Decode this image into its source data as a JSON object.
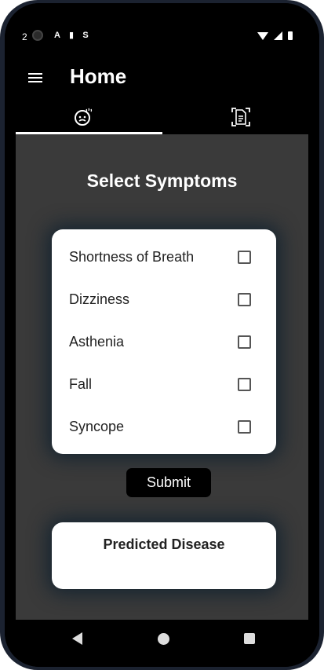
{
  "status_bar": {
    "time": "2",
    "left_icons": [
      "A",
      "▮",
      "S"
    ]
  },
  "app_bar": {
    "title": "Home",
    "menu_icon": "menu-icon"
  },
  "tabs": [
    {
      "icon": "sick-face-icon",
      "active": true
    },
    {
      "icon": "document-scan-icon",
      "active": false
    }
  ],
  "main": {
    "section_title": "Select Symptoms",
    "symptoms": [
      {
        "label": "Shortness of Breath",
        "checked": false
      },
      {
        "label": "Dizziness",
        "checked": false
      },
      {
        "label": "Asthenia",
        "checked": false
      },
      {
        "label": "Fall",
        "checked": false
      },
      {
        "label": "Syncope",
        "checked": false
      }
    ],
    "submit_label": "Submit",
    "result_title": "Predicted Disease"
  },
  "nav_bar": {
    "icons": [
      "back-icon",
      "home-icon",
      "recents-icon"
    ]
  },
  "colors": {
    "background": "#3a3a3a",
    "bar": "#000000",
    "card": "#ffffff",
    "button": "#000000"
  }
}
